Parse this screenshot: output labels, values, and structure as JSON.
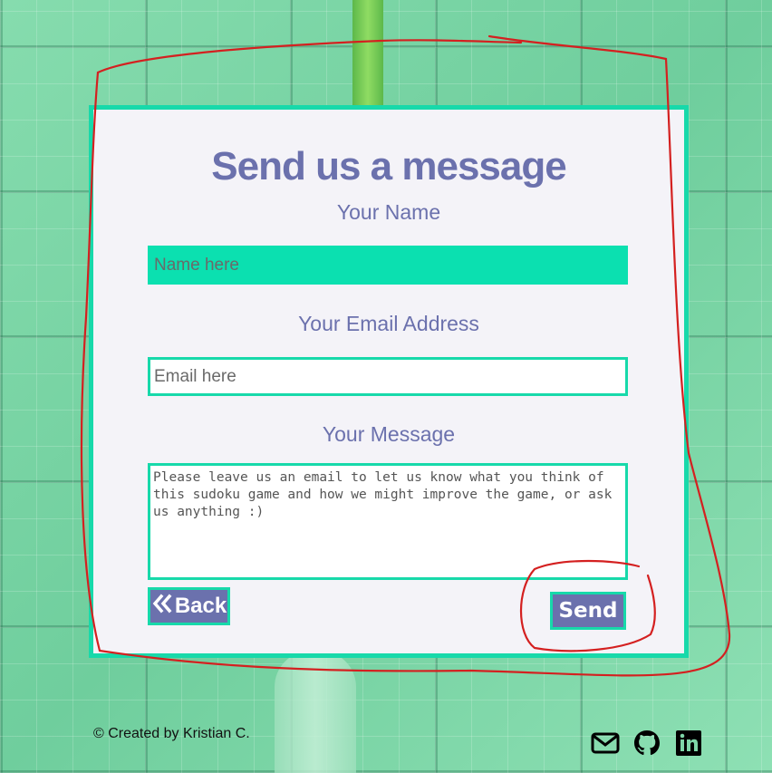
{
  "form": {
    "title": "Send us a message",
    "name_label": "Your Name",
    "name_placeholder": "Name here",
    "email_label": "Your Email Address",
    "email_placeholder": "Email here",
    "message_label": "Your Message",
    "message_placeholder": "Please leave us an email to let us know what you think of this sudoku game and how we might improve the game, or ask us anything :)",
    "back_label": "Back",
    "send_label": "Send"
  },
  "footer": {
    "credit": "© Created by Kristian C.",
    "icons": [
      "envelope-icon",
      "github-icon",
      "linkedin-icon"
    ]
  },
  "colors": {
    "accent": "#17d9aa",
    "brand": "#6b71ad",
    "card_bg": "#f4f3f8",
    "annotation": "#d42020"
  }
}
